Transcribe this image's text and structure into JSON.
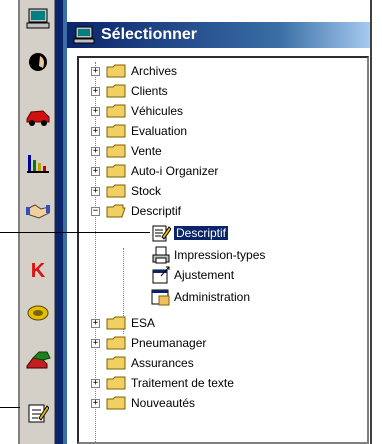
{
  "panel": {
    "title": "Sélectionner"
  },
  "toolbar": {
    "buttons": [
      {
        "name": "computer-icon"
      },
      {
        "name": "person-head-icon"
      },
      {
        "name": "car-red-icon"
      },
      {
        "name": "bar-chart-icon"
      },
      {
        "name": "handshake-icon"
      },
      {
        "name": "k-logo-icon"
      },
      {
        "name": "tire-icon"
      },
      {
        "name": "cars-icon"
      },
      {
        "name": "notepad-pencil-icon"
      }
    ]
  },
  "tree": {
    "folders": [
      {
        "label": "Archives",
        "expander": "+"
      },
      {
        "label": "Clients",
        "expander": "+"
      },
      {
        "label": "Véhicules",
        "expander": "+"
      },
      {
        "label": "Evaluation",
        "expander": "+"
      },
      {
        "label": "Vente",
        "expander": "+"
      },
      {
        "label": "Auto-i Organizer",
        "expander": "+"
      },
      {
        "label": "Stock",
        "expander": "+"
      },
      {
        "label": "Descriptif",
        "expander": "−"
      }
    ],
    "children": [
      {
        "label": "Descriptif",
        "icon": "notepad-pencil-icon",
        "selected": true
      },
      {
        "label": "Impression-types",
        "icon": "printer-doc-icon",
        "selected": false
      },
      {
        "label": "Ajustement",
        "icon": "adjust-icon",
        "selected": false
      },
      {
        "label": "Administration",
        "icon": "admin-window-icon",
        "selected": false
      }
    ],
    "folders_after": [
      {
        "label": "ESA",
        "expander": "+"
      },
      {
        "label": "Pneumanager",
        "expander": "+"
      },
      {
        "label": "Assurances",
        "expander": ""
      },
      {
        "label": "Traitement de texte",
        "expander": "+"
      },
      {
        "label": "Nouveautés",
        "expander": "+"
      }
    ]
  }
}
